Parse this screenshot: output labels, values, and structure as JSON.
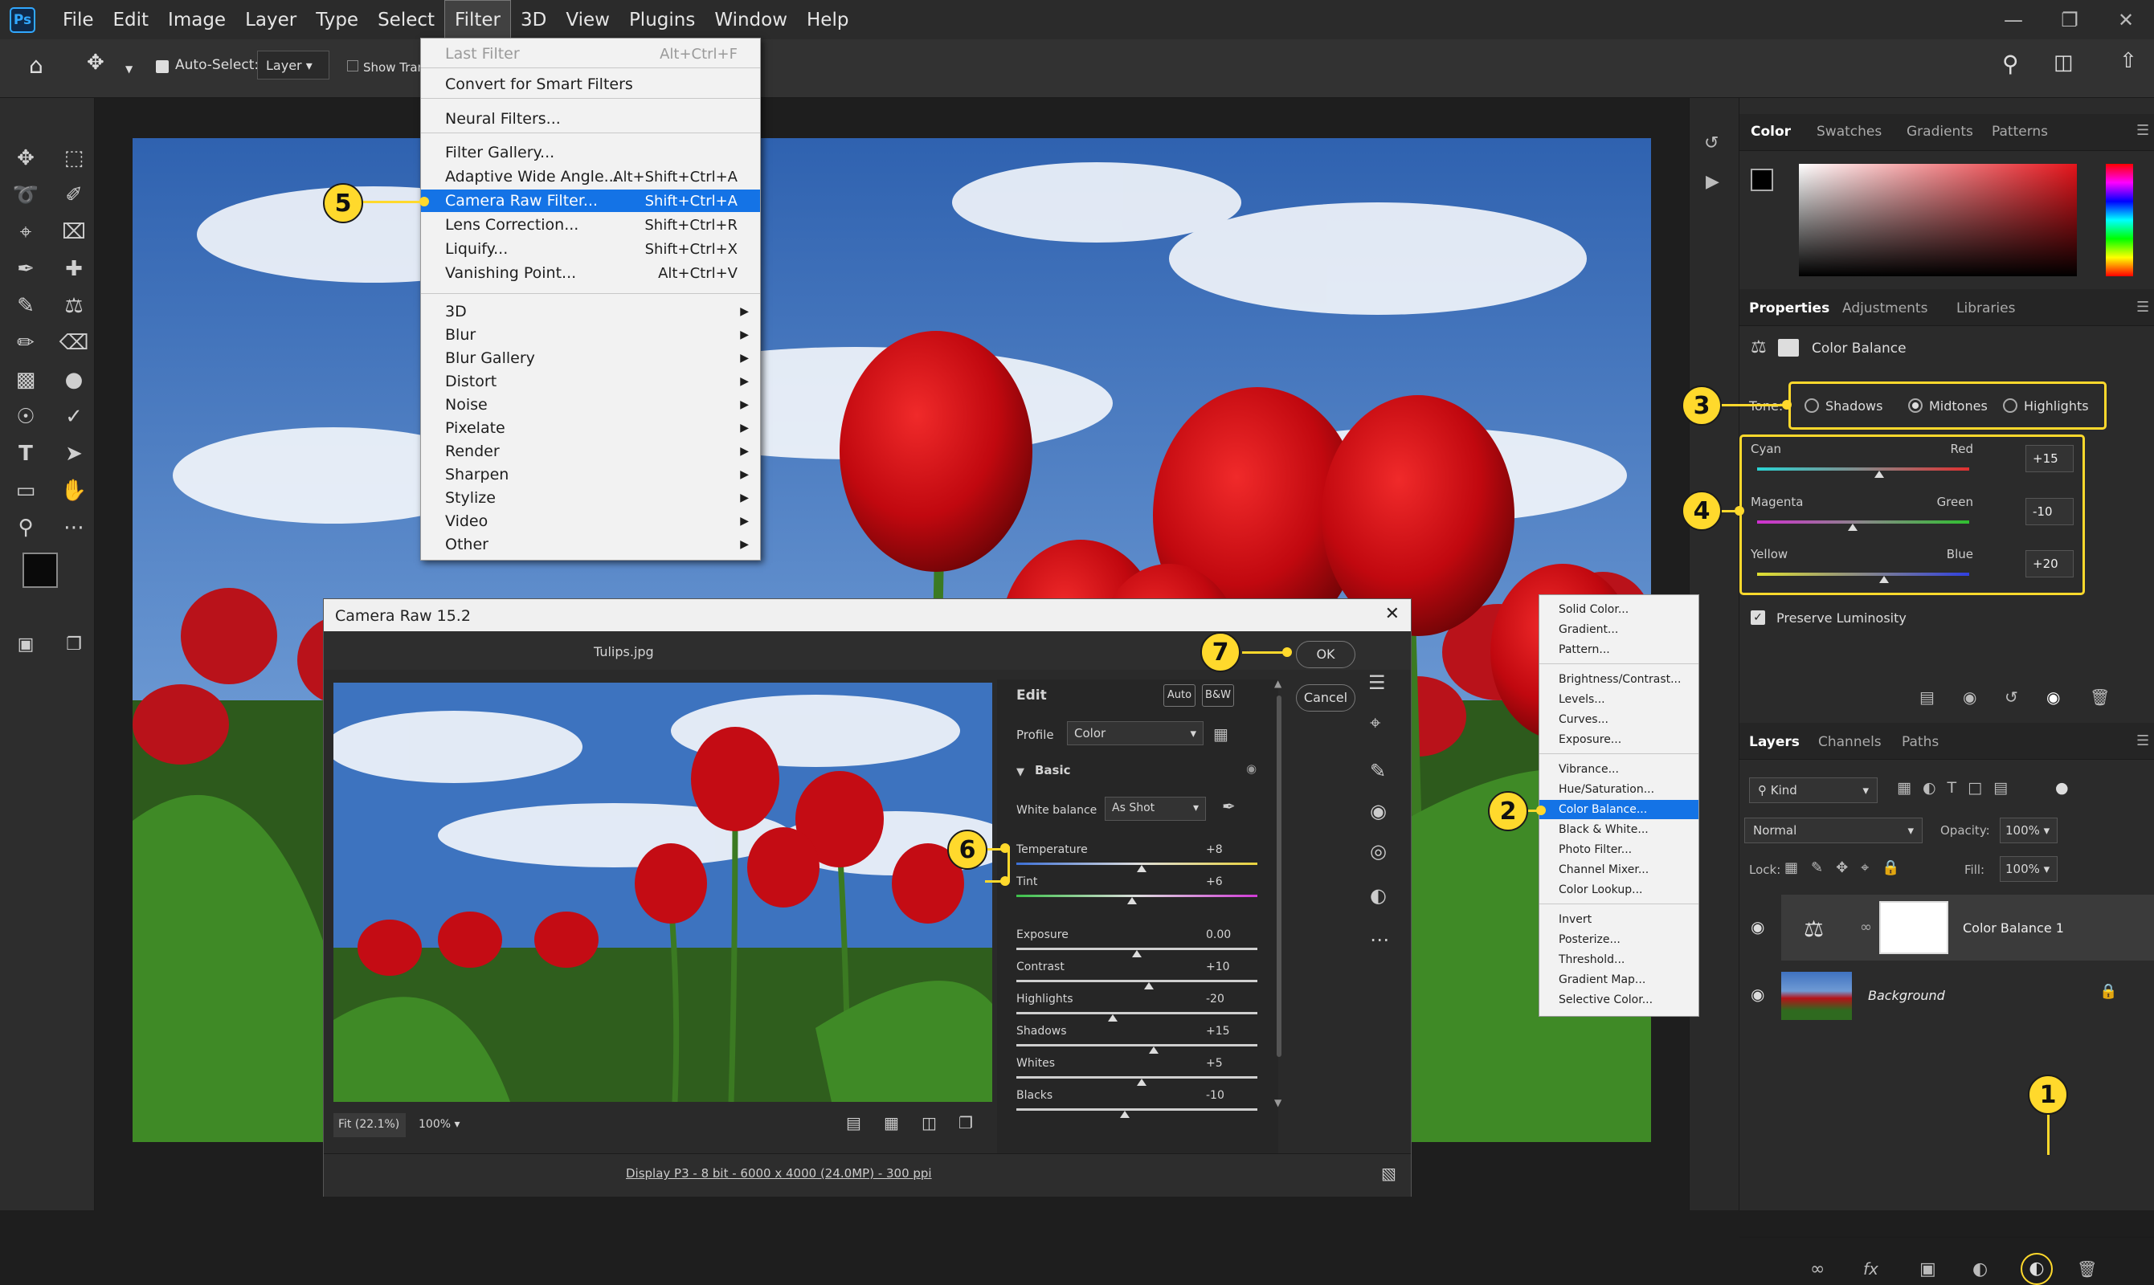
{
  "app": {
    "logo": "Ps"
  },
  "menubar": {
    "items": [
      "File",
      "Edit",
      "Image",
      "Layer",
      "Type",
      "Select",
      "Filter",
      "3D",
      "View",
      "Plugins",
      "Window",
      "Help"
    ]
  },
  "options": {
    "auto_select": "Auto-Select:",
    "layer_dropdown": "Layer",
    "show_transform": "Show Tran"
  },
  "filter_menu": {
    "items": [
      {
        "label": "Last Filter",
        "shortcut": "Alt+Ctrl+F",
        "disabled": true
      },
      {
        "label": "Convert for Smart Filters",
        "shortcut": ""
      },
      {
        "label": "Neural Filters...",
        "shortcut": ""
      },
      {
        "label": "Filter Gallery...",
        "shortcut": ""
      },
      {
        "label": "Adaptive Wide Angle...",
        "shortcut": "Alt+Shift+Ctrl+A"
      },
      {
        "label": "Camera Raw Filter...",
        "shortcut": "Shift+Ctrl+A",
        "highlighted": true
      },
      {
        "label": "Lens Correction...",
        "shortcut": "Shift+Ctrl+R"
      },
      {
        "label": "Liquify...",
        "shortcut": "Shift+Ctrl+X"
      },
      {
        "label": "Vanishing Point...",
        "shortcut": "Alt+Ctrl+V"
      }
    ],
    "submenus": [
      "3D",
      "Blur",
      "Blur Gallery",
      "Distort",
      "Noise",
      "Pixelate",
      "Render",
      "Sharpen",
      "Stylize",
      "Video",
      "Other"
    ]
  },
  "camera_raw": {
    "title": "Camera Raw 15.2",
    "filename": "Tulips.jpg",
    "ok": "OK",
    "cancel": "Cancel",
    "edit": "Edit",
    "auto": "Auto",
    "bw": "B&W",
    "profile_label": "Profile",
    "profile_value": "Color",
    "basic": "Basic",
    "white_balance_label": "White balance",
    "white_balance_value": "As Shot",
    "sliders": [
      {
        "label": "Temperature",
        "value": "+8",
        "pos": 0.52
      },
      {
        "label": "Tint",
        "value": "+6",
        "pos": 0.48
      },
      {
        "label": "Exposure",
        "value": "0.00",
        "pos": 0.5
      },
      {
        "label": "Contrast",
        "value": "+10",
        "pos": 0.55
      },
      {
        "label": "Highlights",
        "value": "-20",
        "pos": 0.4
      },
      {
        "label": "Shadows",
        "value": "+15",
        "pos": 0.57
      },
      {
        "label": "Whites",
        "value": "+5",
        "pos": 0.52
      },
      {
        "label": "Blacks",
        "value": "-10",
        "pos": 0.45
      }
    ],
    "fit": "Fit (22.1%)",
    "zoom": "100%",
    "footer": "Display P3 - 8 bit - 6000 x 4000 (24.0MP) - 300 ppi"
  },
  "color_panel": {
    "tabs": [
      "Color",
      "Swatches",
      "Gradients",
      "Patterns"
    ]
  },
  "properties": {
    "tabs": [
      "Properties",
      "Adjustments",
      "Libraries"
    ],
    "title": "Color Balance",
    "tone_label": "Tone:",
    "tones": [
      "Shadows",
      "Midtones",
      "Highlights"
    ],
    "selected_tone": "Midtones",
    "balance": [
      {
        "left": "Cyan",
        "right": "Red",
        "value": "+15",
        "pos": 0.575,
        "grad": "linear-gradient(90deg,#2ad4d4,#888,#e03030)"
      },
      {
        "left": "Magenta",
        "right": "Green",
        "value": "-10",
        "pos": 0.45,
        "grad": "linear-gradient(90deg,#d030d0,#888,#30c030)"
      },
      {
        "left": "Yellow",
        "right": "Blue",
        "value": "+20",
        "pos": 0.6,
        "grad": "linear-gradient(90deg,#e0e030,#888,#3040e0)"
      }
    ],
    "preserve_luminosity": "Preserve Luminosity"
  },
  "adjustment_menu": {
    "groups": [
      [
        "Solid Color...",
        "Gradient...",
        "Pattern..."
      ],
      [
        "Brightness/Contrast...",
        "Levels...",
        "Curves...",
        "Exposure..."
      ],
      [
        "Vibrance...",
        "Hue/Saturation...",
        "Color Balance...",
        "Black & White...",
        "Photo Filter...",
        "Channel Mixer...",
        "Color Lookup..."
      ],
      [
        "Invert",
        "Posterize...",
        "Threshold...",
        "Gradient Map...",
        "Selective Color..."
      ]
    ],
    "highlighted": "Color Balance..."
  },
  "layers": {
    "tabs": [
      "Layers",
      "Channels",
      "Paths"
    ],
    "kind": "Kind",
    "blend_mode": "Normal",
    "opacity_label": "Opacity:",
    "opacity_value": "100%",
    "lock_label": "Lock:",
    "fill_label": "Fill:",
    "fill_value": "100%",
    "items": [
      {
        "name": "Color Balance 1"
      },
      {
        "name": "Background"
      }
    ]
  },
  "callouts": [
    "1",
    "2",
    "3",
    "4",
    "5",
    "6",
    "7"
  ]
}
